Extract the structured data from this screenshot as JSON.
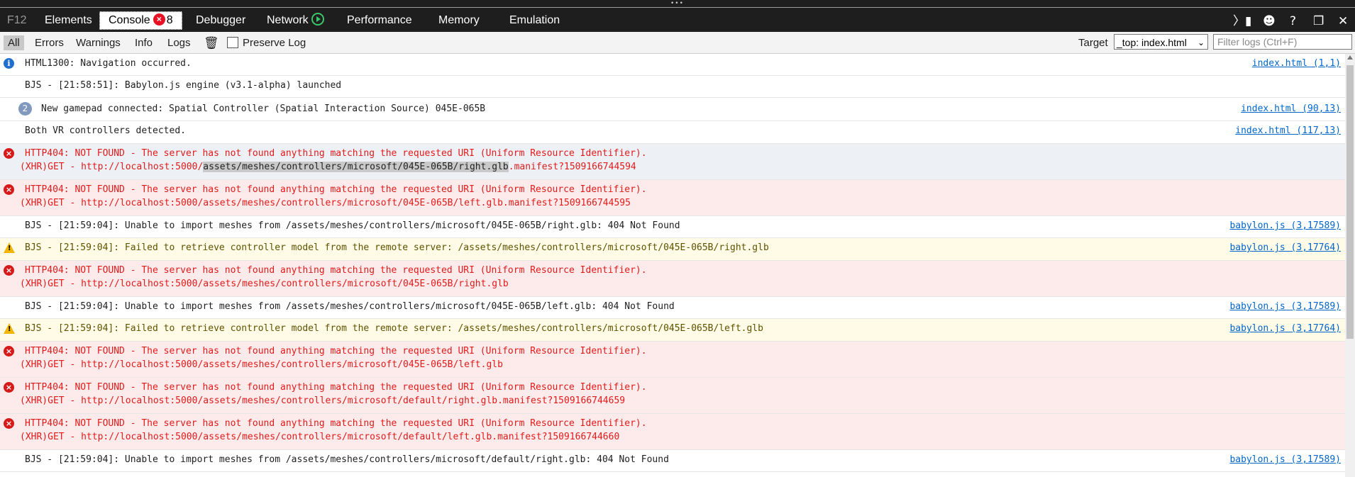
{
  "tabs": {
    "f12": "F12",
    "elements": "Elements",
    "console": "Console",
    "console_error_count": "8",
    "debugger": "Debugger",
    "network": "Network",
    "performance": "Performance",
    "memory": "Memory",
    "emulation": "Emulation"
  },
  "filters": {
    "all": "All",
    "errors": "Errors",
    "warnings": "Warnings",
    "info": "Info",
    "logs": "Logs",
    "preserve_log": "Preserve Log",
    "target_label": "Target",
    "target_value": "_top: index.html",
    "filter_placeholder": "Filter logs (Ctrl+F)"
  },
  "messages": [
    {
      "type": "info",
      "text": "HTML1300: Navigation occurred.",
      "source": "index.html (1,1)"
    },
    {
      "type": "log",
      "text": "BJS - [21:58:51]: Babylon.js engine (v3.1-alpha) launched",
      "source": ""
    },
    {
      "type": "log",
      "count": "2",
      "text": "New gamepad connected: Spatial Controller (Spatial Interaction Source) 045E-065B",
      "source": "index.html (90,13)"
    },
    {
      "type": "log",
      "text": "Both VR controllers detected.",
      "source": "index.html (117,13)"
    },
    {
      "type": "error",
      "text": "HTTP404: NOT FOUND - The server has not found anything matching the requested URI (Uniform Resource Identifier).",
      "line2a": "(XHR)GET - http://localhost:5000/",
      "line2sel": "assets/meshes/controllers/microsoft/045E-065B/right.glb",
      "line2b": ".manifest?1509166744594"
    },
    {
      "type": "error",
      "text": "HTTP404: NOT FOUND - The server has not found anything matching the requested URI (Uniform Resource Identifier).",
      "line2": "(XHR)GET - http://localhost:5000/assets/meshes/controllers/microsoft/045E-065B/left.glb.manifest?1509166744595"
    },
    {
      "type": "log",
      "text": "BJS - [21:59:04]: Unable to import meshes from /assets/meshes/controllers/microsoft/045E-065B/right.glb: 404 Not Found",
      "source": "babylon.js (3,17589)"
    },
    {
      "type": "warn",
      "text": "BJS - [21:59:04]: Failed to retrieve controller model from the remote server: /assets/meshes/controllers/microsoft/045E-065B/right.glb",
      "source": "babylon.js (3,17764)"
    },
    {
      "type": "error",
      "text": "HTTP404: NOT FOUND - The server has not found anything matching the requested URI (Uniform Resource Identifier).",
      "line2": "(XHR)GET - http://localhost:5000/assets/meshes/controllers/microsoft/045E-065B/right.glb"
    },
    {
      "type": "log",
      "text": "BJS - [21:59:04]: Unable to import meshes from /assets/meshes/controllers/microsoft/045E-065B/left.glb: 404 Not Found",
      "source": "babylon.js (3,17589)"
    },
    {
      "type": "warn",
      "text": "BJS - [21:59:04]: Failed to retrieve controller model from the remote server: /assets/meshes/controllers/microsoft/045E-065B/left.glb",
      "source": "babylon.js (3,17764)"
    },
    {
      "type": "error",
      "text": "HTTP404: NOT FOUND - The server has not found anything matching the requested URI (Uniform Resource Identifier).",
      "line2": "(XHR)GET - http://localhost:5000/assets/meshes/controllers/microsoft/045E-065B/left.glb"
    },
    {
      "type": "error",
      "text": "HTTP404: NOT FOUND - The server has not found anything matching the requested URI (Uniform Resource Identifier).",
      "line2": "(XHR)GET - http://localhost:5000/assets/meshes/controllers/microsoft/default/right.glb.manifest?1509166744659"
    },
    {
      "type": "error",
      "text": "HTTP404: NOT FOUND - The server has not found anything matching the requested URI (Uniform Resource Identifier).",
      "line2": "(XHR)GET - http://localhost:5000/assets/meshes/controllers/microsoft/default/left.glb.manifest?1509166744660"
    },
    {
      "type": "log",
      "text": "BJS - [21:59:04]: Unable to import meshes from /assets/meshes/controllers/microsoft/default/right.glb: 404 Not Found",
      "source": "babylon.js (3,17589)"
    }
  ]
}
